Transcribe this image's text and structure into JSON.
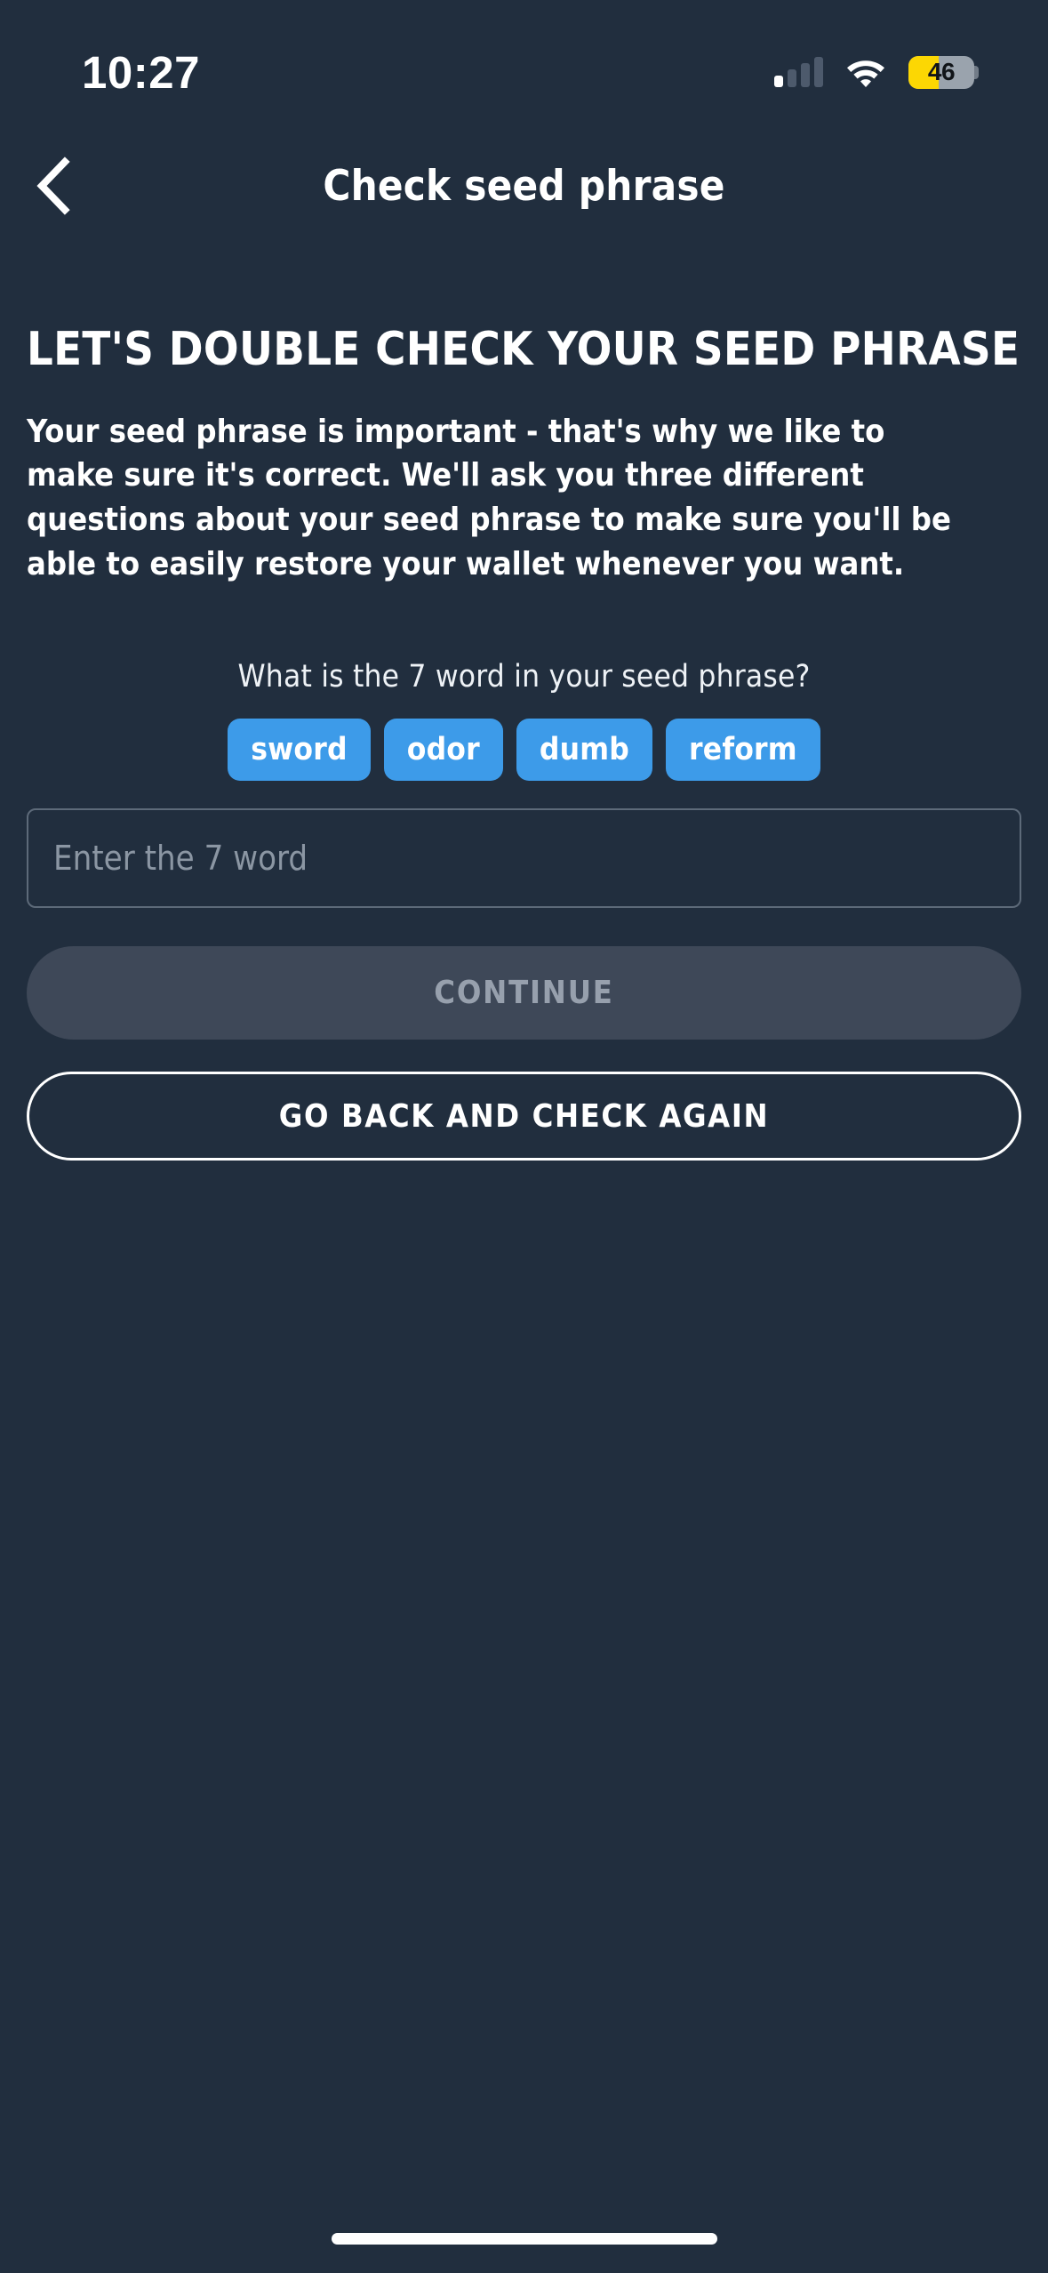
{
  "status_bar": {
    "time": "10:27",
    "battery_level": "46",
    "battery_percent": 46,
    "signal_icon": "cellular-signal-icon",
    "wifi_icon": "wifi-icon",
    "battery_icon": "battery-icon",
    "colors": {
      "battery_fill": "#fcd703",
      "battery_track": "#9aa3ad"
    }
  },
  "nav": {
    "back_icon": "chevron-left-icon",
    "title": "Check seed phrase"
  },
  "main": {
    "headline": "LET'S DOUBLE CHECK YOUR SEED PHRASE",
    "body": "Your seed phrase is important - that's why we like to make sure it's correct. We'll ask you three different questions about your seed phrase to make sure you'll be able to easily restore your wallet whenever you want.",
    "question": "What is the 7 word in your seed phrase?",
    "word_options": [
      {
        "label": "sword"
      },
      {
        "label": "odor"
      },
      {
        "label": "dumb"
      },
      {
        "label": "reform"
      }
    ],
    "input": {
      "placeholder": "Enter the 7 word",
      "value": ""
    },
    "primary_button": {
      "label": "CONTINUE",
      "disabled": true
    },
    "secondary_button": {
      "label": "GO BACK AND CHECK AGAIN"
    }
  },
  "theme": {
    "background": "#212e3e",
    "accent_blue": "#3d9be9",
    "disabled_button": "#3e4858",
    "text_primary": "#ffffff",
    "text_muted": "#8b96a3"
  }
}
